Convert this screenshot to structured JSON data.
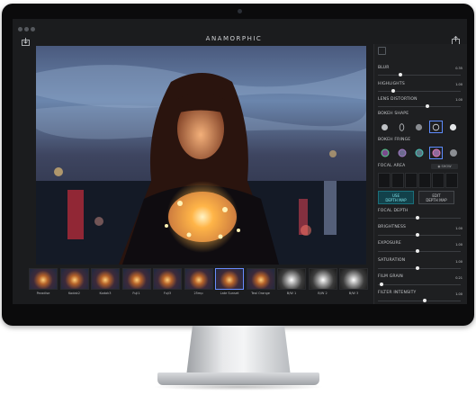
{
  "app": {
    "title": "ANAMORPHIC"
  },
  "icons": {
    "import": "import-icon",
    "share": "share-icon",
    "window_controls": [
      "close-dot",
      "minimize-dot",
      "zoom-dot"
    ]
  },
  "colors": {
    "accent_blue": "#5e8cff",
    "use_depth_bg": "#12414a",
    "use_depth_text": "#7fe3ea",
    "panel_bg": "#1e1f21"
  },
  "panel": {
    "sliders_top": [
      {
        "label": "BLUR",
        "value": "0.35",
        "level": 0.27
      },
      {
        "label": "HIGHLIGHTS",
        "value": "1.00",
        "level": 0.18
      },
      {
        "label": "LENS DISTORTION",
        "value": "1.00",
        "level": 0.6
      }
    ],
    "bokeh_shape": {
      "label": "BOKEH SHAPE",
      "options": [
        "circle-shape",
        "oval-shape",
        "soft-circle-shape",
        "disc-shape",
        "ring-shape"
      ],
      "selected_index": 3
    },
    "bokeh_fringe": {
      "label": "BOKEH FRINGE",
      "options": [
        "fringe-green-magenta",
        "fringe-purple",
        "fringe-teal",
        "fringe-pink",
        "fringe-grey"
      ],
      "selected_index": 3
    },
    "focal_area": {
      "label": "FOCAL AREA",
      "show_label": "SHOW",
      "cells": 6
    },
    "depth_buttons": {
      "use": [
        "USE",
        "DEPTH MAP"
      ],
      "edit": [
        "EDIT",
        "DEPTH MAP"
      ]
    },
    "sliders_bottom": [
      {
        "label": "FOCAL DEPTH",
        "value": "",
        "level": 0.48
      },
      {
        "label": "BRIGHTNESS",
        "value": "1.00",
        "level": 0.48
      },
      {
        "label": "EXPOSURE",
        "value": "1.00",
        "level": 0.48
      },
      {
        "label": "SATURATION",
        "value": "1.00",
        "level": 0.48
      },
      {
        "label": "FILM GRAIN",
        "value": "0.21",
        "level": 0.04
      },
      {
        "label": "FILTER INTENSITY",
        "value": "1.00",
        "level": 0.56
      }
    ]
  },
  "filmstrip": [
    {
      "label": "Paradise",
      "bw": false
    },
    {
      "label": "Kodak2",
      "bw": false
    },
    {
      "label": "Kodak3",
      "bw": false
    },
    {
      "label": "Fuji1",
      "bw": false
    },
    {
      "label": "Fuji3",
      "bw": false
    },
    {
      "label": "25mp",
      "bw": false
    },
    {
      "label": "Late Sunset",
      "bw": false,
      "selected": true
    },
    {
      "label": "Teal Orange",
      "bw": false
    },
    {
      "label": "B/W 1",
      "bw": true
    },
    {
      "label": "B/W 2",
      "bw": true
    },
    {
      "label": "B/W 3",
      "bw": true
    }
  ]
}
